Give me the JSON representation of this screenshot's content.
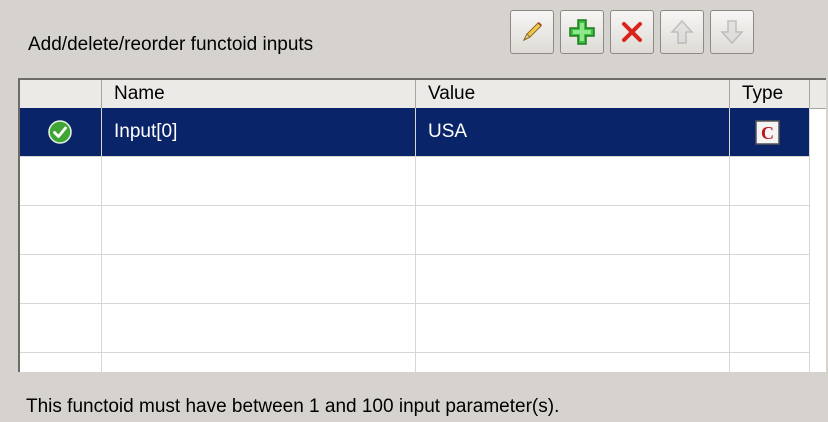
{
  "panel": {
    "title": "Add/delete/reorder functoid inputs"
  },
  "toolbar": {
    "edit_icon": "pencil-icon",
    "add_icon": "green-plus-icon",
    "delete_icon": "red-x-icon",
    "move_up_icon": "arrow-up-icon",
    "move_down_icon": "arrow-down-icon"
  },
  "table": {
    "columns": [
      "",
      "Name",
      "Value",
      "Type"
    ],
    "rows": [
      {
        "status_icon": "green-check-icon",
        "name": "Input[0]",
        "value": "USA",
        "type_icon": "constant-c-icon",
        "selected": true
      },
      {
        "name": "",
        "value": ""
      },
      {
        "name": "",
        "value": ""
      },
      {
        "name": "",
        "value": ""
      },
      {
        "name": "",
        "value": ""
      }
    ]
  },
  "footer": {
    "message": "This functoid must have between 1 and 100 input parameter(s)."
  },
  "colors": {
    "selection": "#0a246a",
    "background": "#d6d3ce"
  }
}
